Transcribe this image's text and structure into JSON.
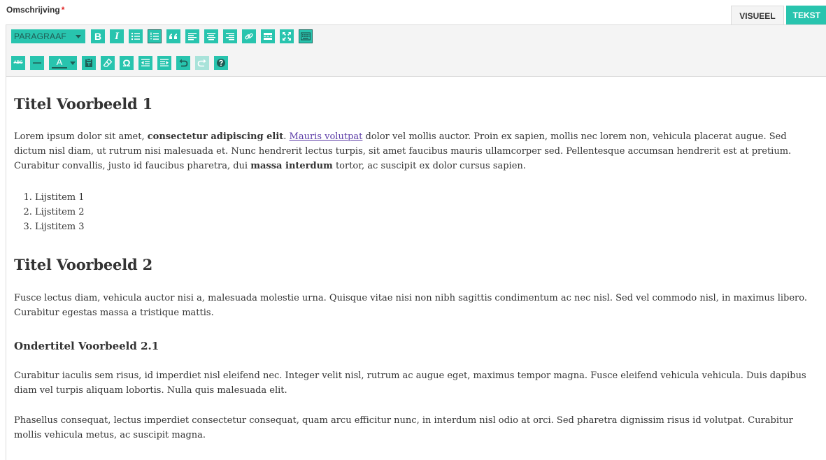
{
  "field": {
    "label": "Omschrijving",
    "required_mark": "*"
  },
  "tabs": {
    "visual": "VISUEEL",
    "text": "TEKST"
  },
  "colors": {
    "accent": "#28c4ae",
    "dark": "#1f5d55",
    "text": "#333333",
    "link": "#5a3aa6",
    "required": "#e02020"
  },
  "toolbar": {
    "format_select": "PARAGRAAF",
    "row1_icons": [
      "bold-icon",
      "italic-icon",
      "bullet-list-icon",
      "numbered-list-icon",
      "blockquote-icon",
      "align-left-icon",
      "align-center-icon",
      "align-right-icon",
      "link-icon",
      "read-more-icon",
      "fullscreen-icon",
      "toolbar-toggle-icon"
    ],
    "row2_icons": [
      "strikethrough-icon",
      "horizontal-line-icon",
      "text-color-icon",
      "paste-as-text-icon",
      "clear-formatting-icon",
      "special-character-icon",
      "outdent-icon",
      "indent-icon",
      "undo-icon",
      "redo-icon",
      "help-icon"
    ],
    "bold_label": "B",
    "italic_label": "I",
    "color_label": "A",
    "omega_label": "Ω",
    "strike_label": "ABC"
  },
  "content": {
    "h1_1": "Titel Voorbeeld 1",
    "p1": {
      "t1": "Lorem ipsum dolor sit amet, ",
      "b1": "consectetur adipiscing elit",
      "t2": ". ",
      "link": "Mauris volutpat",
      "t3": " dolor vel mollis auctor. Proin ex sapien, mollis nec lorem non, vehicula placerat augue. Sed dictum nisl diam, ut rutrum nisi malesuada et. Nunc hendrerit lectus turpis, sit amet faucibus mauris ullamcorper sed. Pellentesque accumsan hendrerit est at pretium. Curabitur convallis, justo id faucibus pharetra, dui ",
      "b2": "massa interdum",
      "t4": " tortor, ac suscipit ex dolor cursus sapien."
    },
    "list": [
      "Lijstitem 1",
      "Lijstitem 2",
      "Lijstitem 3"
    ],
    "h1_2": "Titel Voorbeeld 2",
    "p2": "Fusce lectus diam, vehicula auctor nisi a, malesuada molestie urna. Quisque vitae nisi non nibh sagittis condimentum ac nec nisl. Sed vel commodo nisl, in maximus libero. Curabitur egestas massa a tristique mattis.",
    "h3": "Ondertitel Voorbeeld 2.1",
    "p3": "Curabitur iaculis sem risus, id imperdiet nisl eleifend nec. Integer velit nisl, rutrum ac augue eget, maximus tempor magna. Fusce eleifend vehicula vehicula. Duis dapibus diam vel turpis aliquam lobortis. Nulla quis malesuada elit.",
    "p4": "Phasellus consequat, lectus imperdiet consectetur consequat, quam arcu efficitur nunc, in interdum nisl odio at orci. Sed pharetra dignissim risus id volutpat. Curabitur mollis vehicula metus, ac suscipit magna."
  }
}
